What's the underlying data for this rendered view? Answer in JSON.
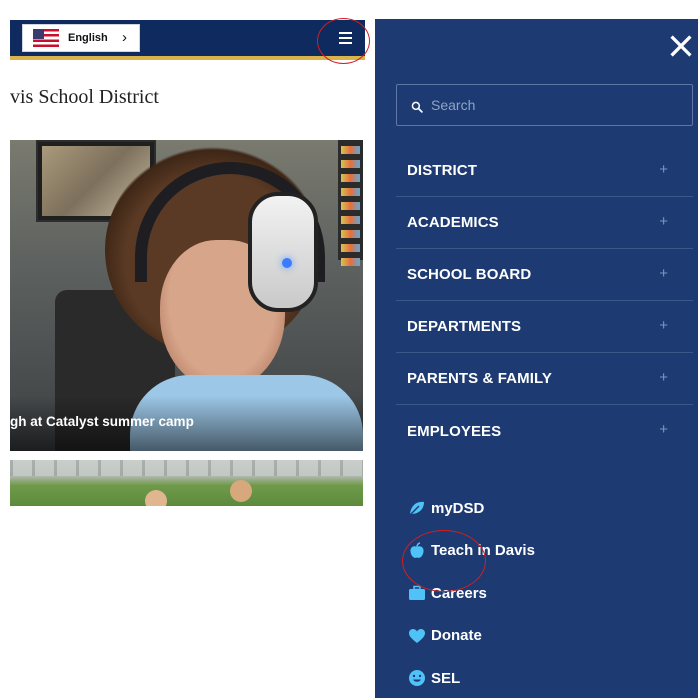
{
  "header": {
    "language": {
      "label": "English",
      "chevron": "›",
      "flag_icon": "us-flag-icon"
    },
    "menu_icon": "hamburger-icon",
    "colors": {
      "bar": "#0f2a5e",
      "stripe": "#d9b44a"
    }
  },
  "page": {
    "title": "vis School District",
    "hero_caption": "gh at Catalyst summer camp"
  },
  "nav": {
    "close_icon": "close-icon",
    "search": {
      "placeholder": "Search",
      "icon": "search-icon"
    },
    "items": [
      {
        "label": "DISTRICT",
        "expand": "+"
      },
      {
        "label": "ACADEMICS",
        "expand": "+"
      },
      {
        "label": "SCHOOL BOARD",
        "expand": "+"
      },
      {
        "label": "DEPARTMENTS",
        "expand": "+"
      },
      {
        "label": "PARENTS & FAMILY",
        "expand": "+"
      },
      {
        "label": "EMPLOYEES",
        "expand": "+"
      }
    ],
    "quick_links": [
      {
        "label": "myDSD",
        "icon": "leaf-icon"
      },
      {
        "label": "Teach in Davis",
        "icon": "apple-icon"
      },
      {
        "label": "Careers",
        "icon": "briefcase-icon"
      },
      {
        "label": "Donate",
        "icon": "heart-icon"
      },
      {
        "label": "SEL",
        "icon": "smiley-icon"
      }
    ],
    "colors": {
      "panel": "#1d3b72",
      "divider": "#3b5888",
      "quick_icon": "#4fc3f7"
    }
  },
  "annotations": {
    "highlight_color": "#d11f1f"
  }
}
